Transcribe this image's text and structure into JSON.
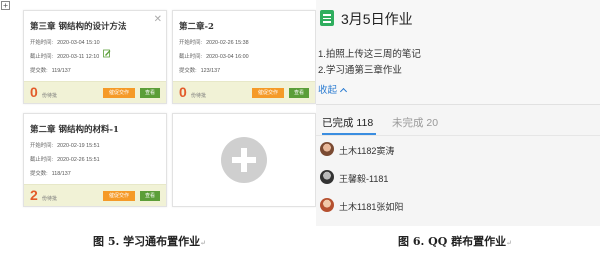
{
  "left_figure": {
    "cards": [
      {
        "title": "第三章 钢结构的设计方法",
        "start_label": "开始时间:",
        "start_value": "2020-03-04 15:10",
        "end_label": "截止时间:",
        "end_value": "2020-03-11 12:10",
        "submit_label": "提交数:",
        "submit_value": "119/137",
        "pending_count": "0",
        "pending_label": "份待批",
        "remind_label": "催促交作",
        "view_label": "查看"
      },
      {
        "title": "第二章-2",
        "start_label": "开始时间:",
        "start_value": "2020-02-26 15:38",
        "end_label": "截止时间:",
        "end_value": "2020-03-04 16:00",
        "submit_label": "提交数:",
        "submit_value": "123/137",
        "pending_count": "0",
        "pending_label": "份待批",
        "remind_label": "催促交作",
        "view_label": "查看"
      },
      {
        "title": "第二章 钢结构的材料-1",
        "start_label": "开始时间:",
        "start_value": "2020-02-19 15:51",
        "end_label": "截止时间:",
        "end_value": "2020-02-26 15:51",
        "submit_label": "提交数:",
        "submit_value": "118/137",
        "pending_count": "2",
        "pending_label": "份待批",
        "remind_label": "催促交作",
        "view_label": "查看"
      }
    ],
    "caption": "图 5.  学习通布置作业"
  },
  "right_figure": {
    "title": "3月5日作业",
    "line1": "1.拍照上传这三周的笔记",
    "line2": "2.学习通第三章作业",
    "collapse_label": "收起",
    "tab_done": "已完成 118",
    "tab_undone": "未完成 20",
    "members": [
      "土木1182窦涛",
      "王馨毅-1181",
      "土木1181张如阳"
    ],
    "caption": "图 6. QQ 群布置作业"
  },
  "para_mark": "↵",
  "colors": {
    "accent_red": "#e35b2a",
    "button_orange": "#f59a28",
    "button_green": "#5b9e38",
    "qq_blue": "#3a8de0",
    "doc_green": "#2fae5e"
  }
}
